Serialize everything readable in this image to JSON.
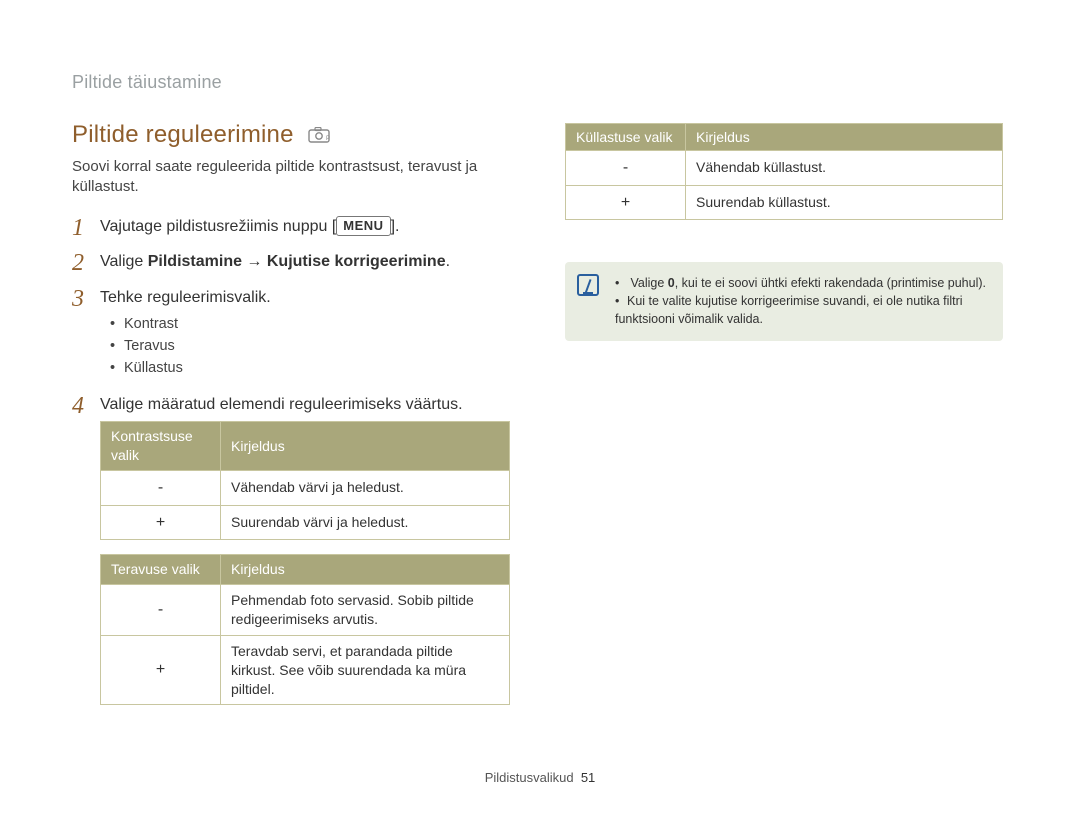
{
  "header": {
    "breadcrumb": "Piltide täiustamine"
  },
  "title": "Piltide reguleerimine",
  "icon_name": "camera-icon",
  "intro": "Soovi korral saate reguleerida piltide kontrastsust, teravust ja küllastust.",
  "steps": {
    "s1_pre": "Vajutage pildistusrežiimis nuppu [",
    "s1_btn": "MENU",
    "s1_post": "].",
    "s2_pre": "Valige ",
    "s2_bold": "Pildistamine → Kujutise korrigeerimine",
    "s2_post": ".",
    "s3": "Tehke reguleerimisvalik.",
    "s3_items": [
      "Kontrast",
      "Teravus",
      "Küllastus"
    ],
    "s4": "Valige määratud elemendi reguleerimiseks väärtus."
  },
  "tables": {
    "contrast": {
      "h1": "Kontrastsuse valik",
      "h2": "Kirjeldus",
      "rows": [
        {
          "sym": "-",
          "desc": "Vähendab värvi ja heledust."
        },
        {
          "sym": "+",
          "desc": "Suurendab värvi ja heledust."
        }
      ]
    },
    "sharpness": {
      "h1": "Teravuse valik",
      "h2": "Kirjeldus",
      "rows": [
        {
          "sym": "-",
          "desc": "Pehmendab foto servasid. Sobib piltide redigeerimiseks arvutis."
        },
        {
          "sym": "+",
          "desc": "Teravdab servi, et parandada piltide kirkust. See võib suurendada ka müra piltidel."
        }
      ]
    },
    "saturation": {
      "h1": "Küllastuse valik",
      "h2": "Kirjeldus",
      "rows": [
        {
          "sym": "-",
          "desc": "Vähendab küllastust."
        },
        {
          "sym": "+",
          "desc": "Suurendab küllastust."
        }
      ]
    }
  },
  "notes": {
    "n1_pre": "Valige ",
    "n1_bold": "0",
    "n1_post": ", kui te ei soovi ühtki efekti rakendada (printimise puhul).",
    "n2": "Kui te valite kujutise korrigeerimise suvandi, ei ole nutika filtri funktsiooni võimalik valida."
  },
  "footer": {
    "label": "Pildistusvalikud",
    "page": "51"
  }
}
